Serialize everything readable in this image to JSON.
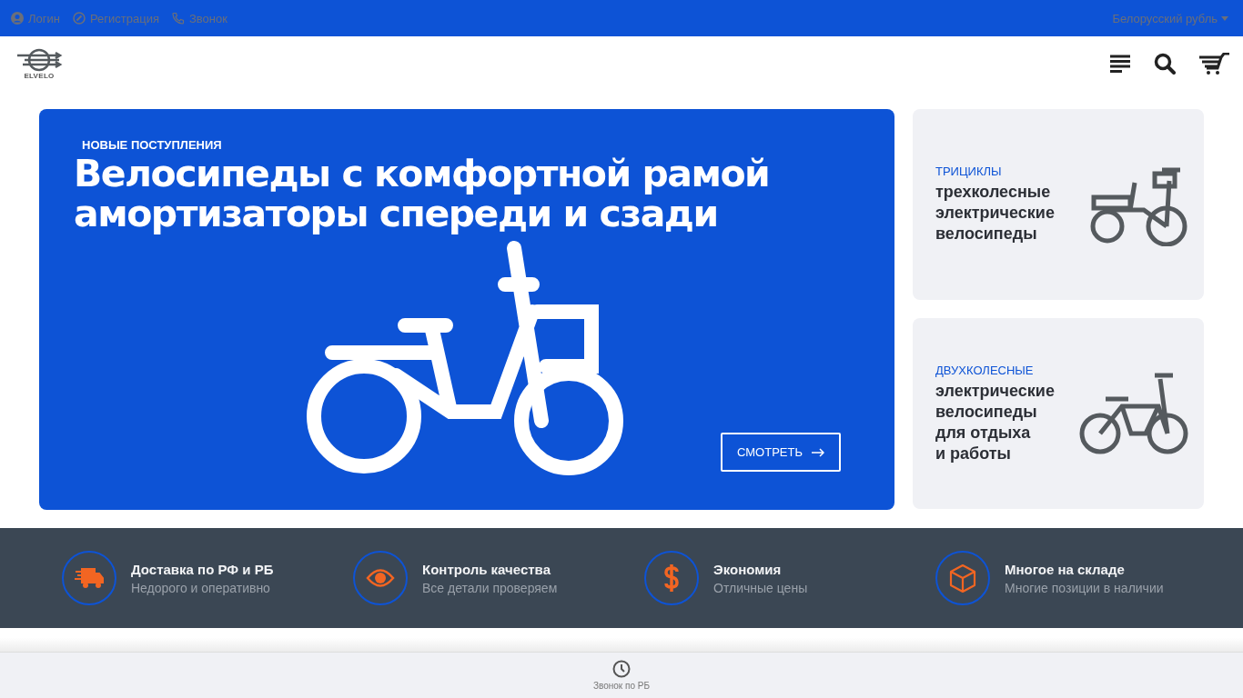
{
  "top_bar": {
    "links": [
      {
        "kind": "user",
        "label": "Логин"
      },
      {
        "kind": "compass",
        "label": "Регистрация"
      },
      {
        "kind": "phone",
        "label": "Звонок"
      }
    ],
    "currency": "Белорусский рубль"
  },
  "header": {
    "logo_text": "ELVELO"
  },
  "hero": {
    "eyebrow": "НОВЫЕ ПОСТУПЛЕНИЯ",
    "title_lines": [
      "Велосипеды с комфортной рамой",
      "амортизаторы спереди и сзади"
    ],
    "button": "СМОТРЕТЬ"
  },
  "side_cards": [
    {
      "kind": "tricycle",
      "category": "ТРИЦИКЛЫ",
      "title_lines": [
        "трехколесные",
        "электрические",
        "велосипеды"
      ]
    },
    {
      "kind": "bicycle",
      "category": "ДВУХКОЛЕСНЫЕ",
      "title_lines": [
        "электрические",
        "велосипеды",
        "для отдыха",
        "и работы"
      ]
    }
  ],
  "features": [
    {
      "kind": "truck",
      "title": "Доставка по РФ и РБ",
      "subtitle": "Недорого и оперативно"
    },
    {
      "kind": "eye",
      "title": "Контроль качества",
      "subtitle": "Все детали проверяем"
    },
    {
      "kind": "dollar",
      "title": "Экономия",
      "subtitle": "Отличные цены"
    },
    {
      "kind": "box",
      "title": "Многое на складе",
      "subtitle": "Многие позиции в наличии"
    }
  ],
  "bottom_bar": {
    "label": "Звонок по РБ"
  }
}
